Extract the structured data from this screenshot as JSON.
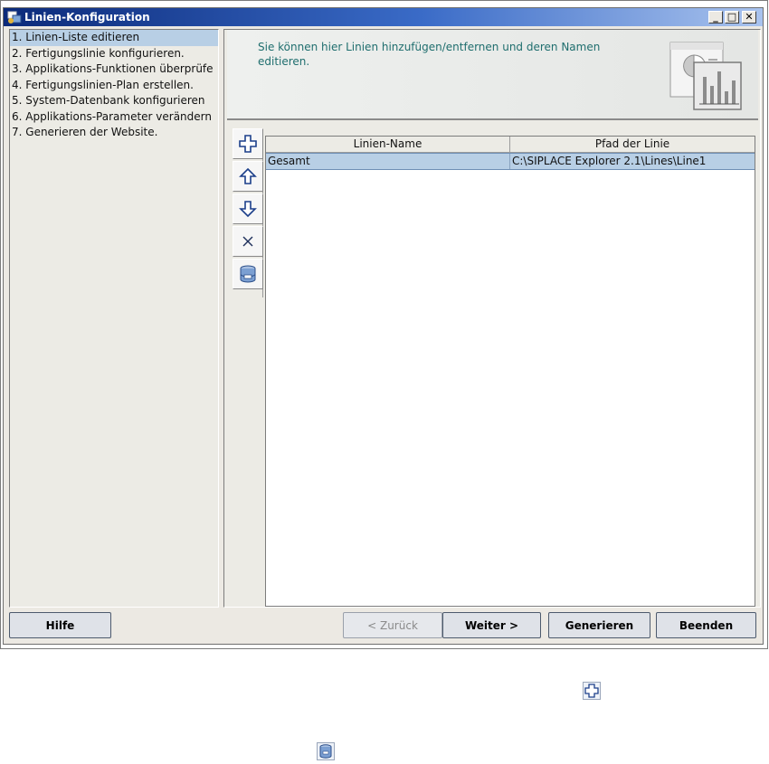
{
  "window": {
    "title": "Linien-Konfiguration",
    "accent_color": "#0b2a7a"
  },
  "window_controls": [
    {
      "name": "minimize",
      "glyph": "_"
    },
    {
      "name": "maximize",
      "glyph": "□"
    },
    {
      "name": "close",
      "glyph": "✕"
    }
  ],
  "steps": [
    {
      "label": "1. Linien-Liste editieren",
      "selected": true
    },
    {
      "label": "2. Fertigungslinie konfigurieren.",
      "selected": false
    },
    {
      "label": "3. Applikations-Funktionen überprüfe",
      "selected": false
    },
    {
      "label": "4. Fertigungslinien-Plan erstellen.",
      "selected": false
    },
    {
      "label": "5. System-Datenbank konfigurieren",
      "selected": false
    },
    {
      "label": "6. Applikations-Parameter verändern",
      "selected": false
    },
    {
      "label": "7. Generieren der Website.",
      "selected": false
    }
  ],
  "info": {
    "text": "Sie können hier Linien hinzufügen/entfernen und deren Namen editieren.",
    "text_color": "#1f6e6e"
  },
  "toolbar": [
    {
      "name": "add",
      "icon": "plus-icon"
    },
    {
      "name": "move-up",
      "icon": "arrow-up-icon"
    },
    {
      "name": "move-down",
      "icon": "arrow-down-icon"
    },
    {
      "name": "delete",
      "icon": "x-icon"
    },
    {
      "name": "database",
      "icon": "database-icon"
    }
  ],
  "table": {
    "columns": [
      "Linien-Name",
      "Pfad der Linie"
    ],
    "rows": [
      [
        "Gesamt",
        "C:\\SIPLACE Explorer 2.1\\Lines\\Line1"
      ]
    ],
    "selection_color": "#b8cfe5"
  },
  "buttons": {
    "help": "Hilfe",
    "back": "< Zurück",
    "next": "Weiter >",
    "generate": "Generieren",
    "finish": "Beenden"
  }
}
